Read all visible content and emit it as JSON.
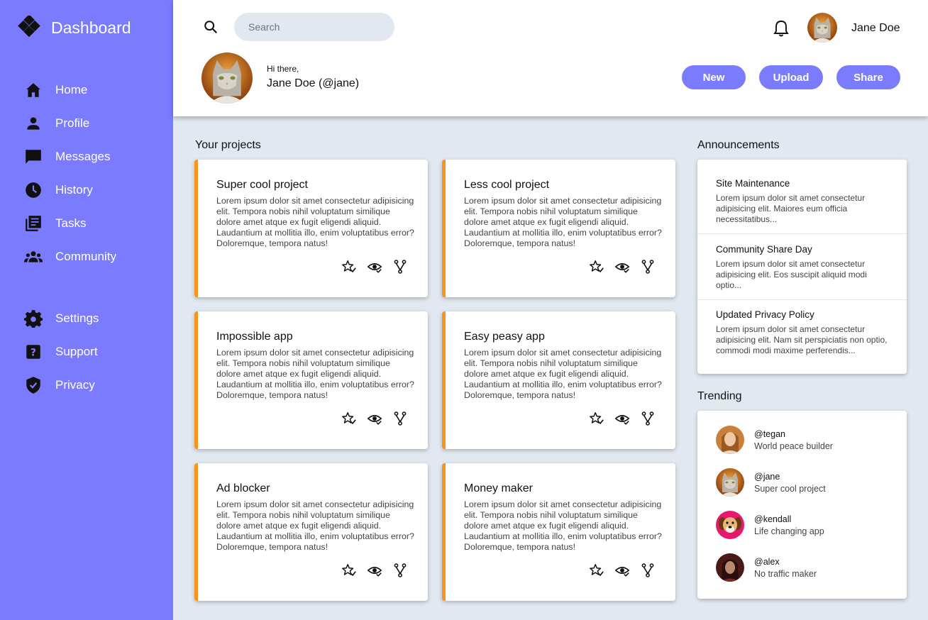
{
  "brand": {
    "title": "Dashboard"
  },
  "sidebar": {
    "items": [
      {
        "label": "Home",
        "icon": "home-icon"
      },
      {
        "label": "Profile",
        "icon": "person-icon"
      },
      {
        "label": "Messages",
        "icon": "chat-icon"
      },
      {
        "label": "History",
        "icon": "clock-icon"
      },
      {
        "label": "Tasks",
        "icon": "list-icon"
      },
      {
        "label": "Community",
        "icon": "group-icon"
      },
      {
        "label": "Settings",
        "icon": "gear-icon"
      },
      {
        "label": "Support",
        "icon": "help-icon"
      },
      {
        "label": "Privacy",
        "icon": "shield-icon"
      }
    ]
  },
  "header": {
    "search_placeholder": "Search",
    "user_name": "Jane Doe",
    "greeting": "Hi there,",
    "full_name": "Jane Doe (@jane)",
    "buttons": {
      "new": "New",
      "upload": "Upload",
      "share": "Share"
    }
  },
  "projects": {
    "title": "Your projects",
    "items": [
      {
        "name": "Super cool project",
        "desc": "Lorem ipsum dolor sit amet consectetur adipisicing elit. Tempora nobis nihil voluptatum similique dolore amet atque ex fugit eligendi aliquid. Laudantium at mollitia illo, enim voluptatibus error? Doloremque, tempora natus!"
      },
      {
        "name": "Less cool project",
        "desc": "Lorem ipsum dolor sit amet consectetur adipisicing elit. Tempora nobis nihil voluptatum similique dolore amet atque ex fugit eligendi aliquid. Laudantium at mollitia illo, enim voluptatibus error? Doloremque, tempora natus!"
      },
      {
        "name": "Impossible app",
        "desc": "Lorem ipsum dolor sit amet consectetur adipisicing elit. Tempora nobis nihil voluptatum similique dolore amet atque ex fugit eligendi aliquid. Laudantium at mollitia illo, enim voluptatibus error? Doloremque, tempora natus!"
      },
      {
        "name": "Easy peasy app",
        "desc": "Lorem ipsum dolor sit amet consectetur adipisicing elit. Tempora nobis nihil voluptatum similique dolore amet atque ex fugit eligendi aliquid. Laudantium at mollitia illo, enim voluptatibus error? Doloremque, tempora natus!"
      },
      {
        "name": "Ad blocker",
        "desc": "Lorem ipsum dolor sit amet consectetur adipisicing elit. Tempora nobis nihil voluptatum similique dolore amet atque ex fugit eligendi aliquid. Laudantium at mollitia illo, enim voluptatibus error? Doloremque, tempora natus!"
      },
      {
        "name": "Money maker",
        "desc": "Lorem ipsum dolor sit amet consectetur adipisicing elit. Tempora nobis nihil voluptatum similique dolore amet atque ex fugit eligendi aliquid. Laudantium at mollitia illo, enim voluptatibus error? Doloremque, tempora natus!"
      }
    ]
  },
  "announcements": {
    "title": "Announcements",
    "items": [
      {
        "title": "Site Maintenance",
        "text": "Lorem ipsum dolor sit amet consectetur adipisicing elit. Maiores eum officia necessitatibus..."
      },
      {
        "title": "Community Share Day",
        "text": "Lorem ipsum dolor sit amet consectetur adipisicing elit. Eos suscipit aliquid modi optio..."
      },
      {
        "title": "Updated Privacy Policy",
        "text": "Lorem ipsum dolor sit amet consectetur adipisicing elit. Nam sit perspiciatis non optio, commodi modi maxime perferendis..."
      }
    ]
  },
  "trending": {
    "title": "Trending",
    "items": [
      {
        "handle": "@tegan",
        "desc": "World peace builder"
      },
      {
        "handle": "@jane",
        "desc": "Super cool project"
      },
      {
        "handle": "@kendall",
        "desc": "Life changing app"
      },
      {
        "handle": "@alex",
        "desc": "No traffic maker"
      }
    ]
  },
  "colors": {
    "accent": "#7b7bff",
    "card_border": "#f7931e",
    "background": "#e2e8f0"
  }
}
